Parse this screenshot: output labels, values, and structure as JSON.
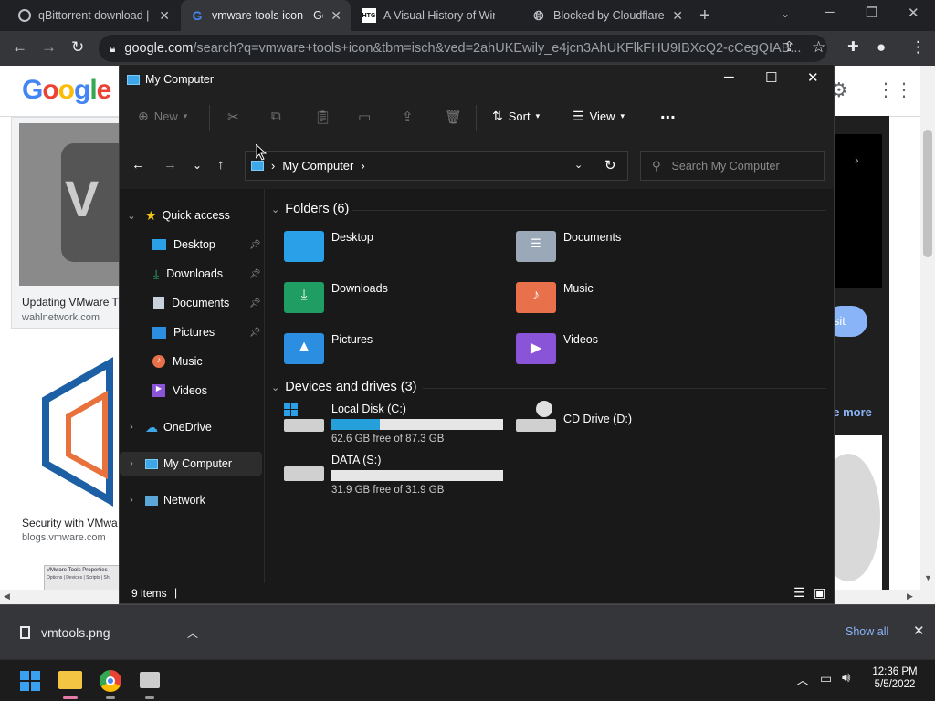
{
  "browser": {
    "tabs": [
      {
        "title": "qBittorrent download |",
        "icon": "qbittorrent-icon",
        "active": false
      },
      {
        "title": "vmware tools icon - Go",
        "icon": "google-icon",
        "active": true
      },
      {
        "title": "A Visual History of Win",
        "icon": "htg-icon",
        "favicon_text": "HTG",
        "active": false
      },
      {
        "title": "Blocked by Cloudflare",
        "icon": "globe-icon",
        "active": false
      }
    ],
    "url_host": "google.com",
    "url_rest": "/search?q=vmware+tools+icon&tbm=isch&ved=2ahUKEwily_e4jcn3AhUKFlkFHU9IBXcQ2-cCegQIAB..."
  },
  "google_page": {
    "logo": "Google",
    "results": [
      {
        "caption": "Updating VMware T",
        "source": "wahlnetwork.com"
      },
      {
        "caption": "Security with VMwa",
        "source": "blogs.vmware.com"
      }
    ],
    "thumb_text": "VMware Tools Properties",
    "thumb_subtext": "Options | Devices | Scripts | Sh",
    "visit_label": "isit",
    "see_more": "ee more"
  },
  "explorer": {
    "window_title": "My Computer",
    "toolbar": {
      "new_label": "New",
      "sort_label": "Sort",
      "view_label": "View",
      "more_label": "..."
    },
    "address": {
      "location": "My Computer"
    },
    "search_placeholder": "Search My Computer",
    "sidebar": {
      "quick_access": "Quick access",
      "items": [
        {
          "label": "Desktop",
          "pinned": true
        },
        {
          "label": "Downloads",
          "pinned": true
        },
        {
          "label": "Documents",
          "pinned": true
        },
        {
          "label": "Pictures",
          "pinned": true
        },
        {
          "label": "Music",
          "pinned": false
        },
        {
          "label": "Videos",
          "pinned": false
        }
      ],
      "onedrive": "OneDrive",
      "my_computer": "My Computer",
      "network": "Network"
    },
    "folders_header": "Folders (6)",
    "folders": [
      {
        "name": "Desktop",
        "color": "#2aa0e8"
      },
      {
        "name": "Documents",
        "color": "#9aa8b8"
      },
      {
        "name": "Downloads",
        "color": "#1f9d63"
      },
      {
        "name": "Music",
        "color": "#e8704a"
      },
      {
        "name": "Pictures",
        "color": "#2b8ee0"
      },
      {
        "name": "Videos",
        "color": "#8a54d8"
      }
    ],
    "drives_header": "Devices and drives (3)",
    "drives": [
      {
        "name": "Local Disk (C:)",
        "free_text": "62.6 GB free of 87.3 GB",
        "used_fraction": 0.283
      },
      {
        "name": "CD Drive (D:)"
      },
      {
        "name": "DATA (S:)",
        "free_text": "31.9 GB free of 31.9 GB",
        "used_fraction": 0.0
      }
    ],
    "status": {
      "items": "9 items"
    }
  },
  "download_shelf": {
    "file": "vmtools.png",
    "show_all": "Show all"
  },
  "taskbar": {
    "time": "12:36 PM",
    "date": "5/5/2022"
  }
}
